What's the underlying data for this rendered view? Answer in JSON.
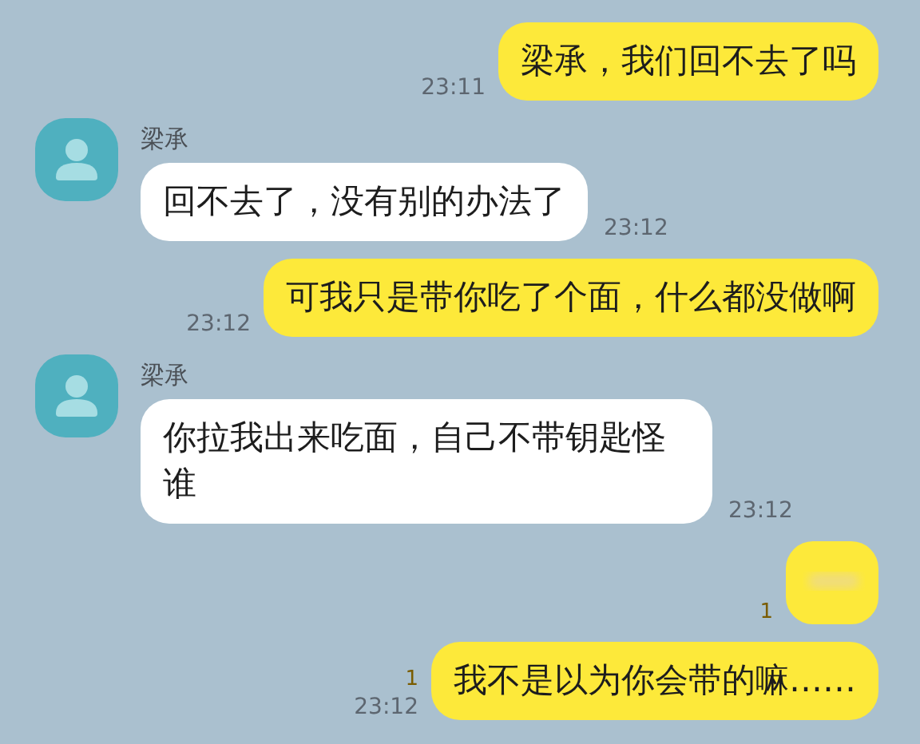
{
  "messages": [
    {
      "kind": "sent",
      "text": "梁承，我们回不去了吗",
      "time": "23:11"
    },
    {
      "kind": "received",
      "sender": "梁承",
      "text": "回不去了，没有别的办法了",
      "time": "23:12"
    },
    {
      "kind": "sent",
      "text": "可我只是带你吃了个面，什么都没做啊",
      "time": "23:12"
    },
    {
      "kind": "received",
      "sender": "梁承",
      "text": "你拉我出来吃面，自己不带钥匙怪谁",
      "time": "23:12"
    },
    {
      "kind": "blurred",
      "unread": "1"
    },
    {
      "kind": "sent",
      "unread": "1",
      "text": "我不是以为你会带的嘛……",
      "time": "23:12"
    }
  ]
}
